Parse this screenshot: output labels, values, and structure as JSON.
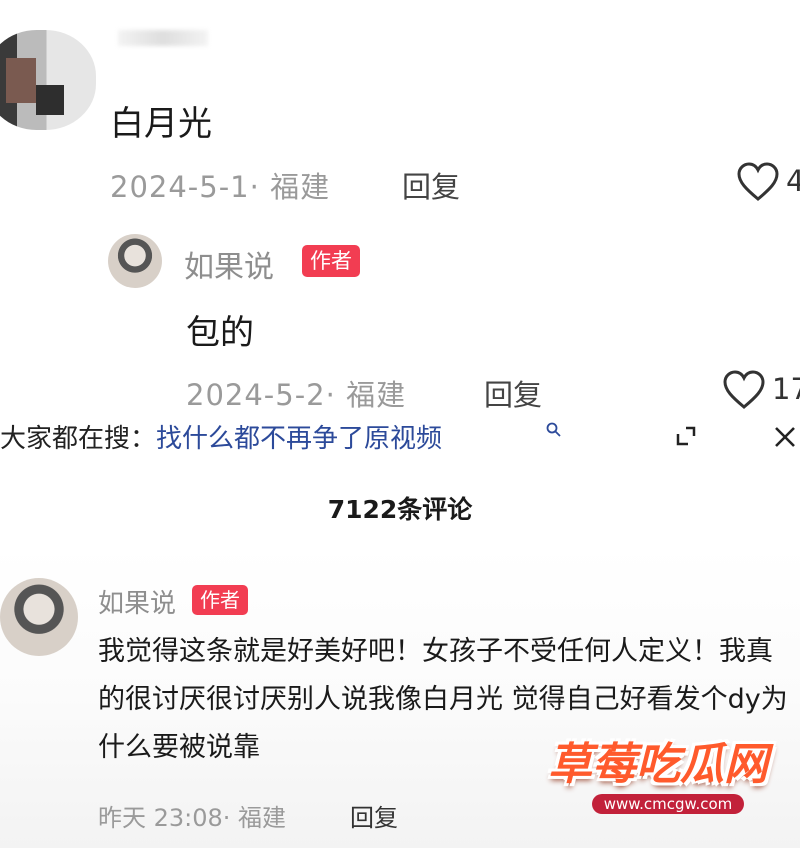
{
  "comment1": {
    "text": "白月光",
    "meta": "2024-5-1· 福建",
    "reply_label": "回复",
    "like_count": "4"
  },
  "reply1": {
    "author": "如果说",
    "author_tag": "作者",
    "text": "包的",
    "meta": "2024-5-2· 福建",
    "reply_label": "回复",
    "like_count": "17"
  },
  "search_bar": {
    "prefix": "大家都在搜：",
    "term": "找什么都不再争了原视频",
    "search_icon": "search-icon",
    "expand_icon": "expand-icon",
    "close_icon": "close-icon"
  },
  "comments_header": {
    "total": "7122条评论"
  },
  "comment2": {
    "author": "如果说",
    "author_tag": "作者",
    "text": "我觉得这条就是好美好吧！女孩子不受任何人定义！我真的很讨厌很讨厌别人说我像白月光 觉得自己好看发个dy为什么要被说靠",
    "meta": "昨天 23:08· 福建",
    "reply_label": "回复"
  },
  "watermark": {
    "title": "草莓吃瓜网",
    "url": "www.cmcgw.com"
  },
  "colors": {
    "author_tag": "#f23d52",
    "meta_gray": "#9a9a9a",
    "search_term": "#2c4a9a",
    "watermark_orange": "#ff5a2c"
  }
}
